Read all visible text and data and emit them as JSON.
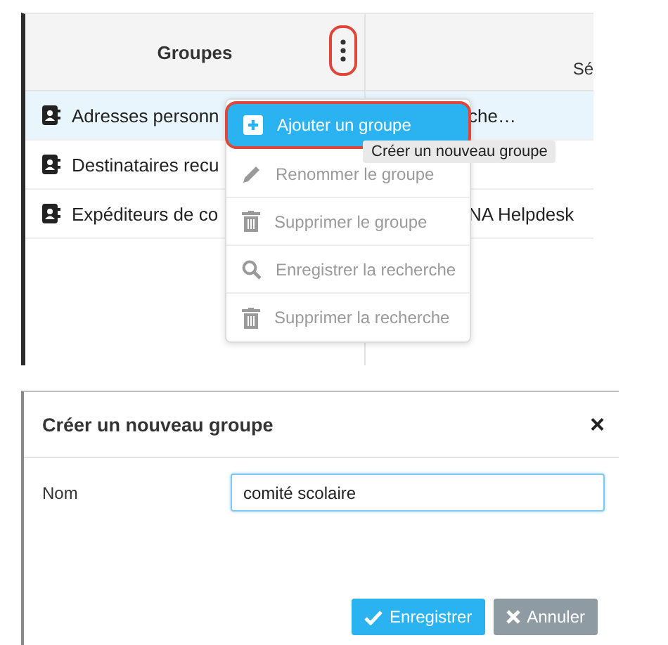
{
  "groups_panel": {
    "header": {
      "title": "Groupes",
      "menu_button_outlined": true
    },
    "column_2": {
      "header": "Sé"
    },
    "rows": [
      {
        "name": "Adresses personn",
        "column_2": "che…",
        "selected": true
      },
      {
        "name": "Destinataires recu",
        "column_2": "",
        "selected": false
      },
      {
        "name": "Expéditeurs de co",
        "column_2": "NA Helpdesk",
        "selected": false
      }
    ]
  },
  "context_menu": {
    "items": [
      {
        "label": "Ajouter un groupe",
        "selected": true,
        "disabled": false
      },
      {
        "label": "Renommer le groupe",
        "selected": false,
        "disabled": true
      },
      {
        "label": "Supprimer le groupe",
        "selected": false,
        "disabled": true
      },
      {
        "label": "Enregistrer la recherche",
        "selected": false,
        "disabled": true
      },
      {
        "label": "Supprimer la recherche",
        "selected": false,
        "disabled": true
      }
    ]
  },
  "tooltip": "Créer un nouveau groupe",
  "dialog": {
    "title": "Créer un nouveau groupe",
    "close": "×",
    "field": {
      "label": "Nom",
      "value": "comité scolaire"
    },
    "buttons": [
      {
        "label": "Enregistrer",
        "kind": "primary"
      },
      {
        "label": "Annuler",
        "kind": "secondary"
      }
    ]
  }
}
